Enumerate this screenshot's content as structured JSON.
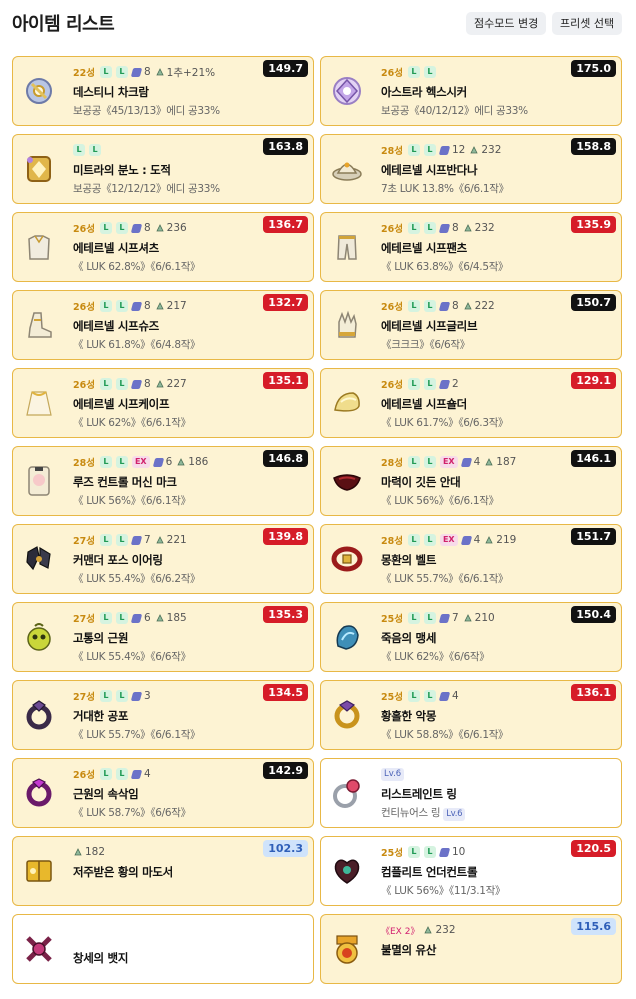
{
  "header": {
    "title": "아이템 리스트",
    "btn_score": "점수모드 변경",
    "btn_preset": "프리셋 선택"
  },
  "items": [
    {
      "star": "22성",
      "l": 2,
      "ex": "",
      "sc": "8",
      "stone": "1추+21%",
      "ex2": "",
      "lv": "",
      "name": "데스티니 차크람",
      "opt": "보공공《45/13/13》에디 공33%",
      "score": "149.7",
      "sc_color": "dark",
      "bg": "yellow",
      "icon": "chakram-icon"
    },
    {
      "star": "26성",
      "l": 2,
      "ex": "",
      "sc": "",
      "stone": "",
      "ex2": "",
      "lv": "",
      "name": "아스트라 헥스시커",
      "opt": "보공공《40/12/12》에디 공33%",
      "score": "175.0",
      "sc_color": "dark",
      "bg": "yellow",
      "icon": "secondary-weapon-icon"
    },
    {
      "star": "",
      "l": 2,
      "ex": "",
      "sc": "",
      "stone": "",
      "ex2": "",
      "lv": "",
      "name": "미트라의 분노 : 도적",
      "opt": "보공공《12/12/12》에디 공33%",
      "score": "163.8",
      "sc_color": "dark",
      "bg": "yellow",
      "icon": "emblem-icon"
    },
    {
      "star": "28성",
      "l": 2,
      "ex": "",
      "sc": "12",
      "stone": "232",
      "ex2": "",
      "lv": "",
      "name": "에테르넬 시프반다나",
      "opt": "7초 LUK 13.8%《6/6.1작》",
      "score": "158.8",
      "sc_color": "dark",
      "bg": "yellow",
      "icon": "hat-icon"
    },
    {
      "star": "26성",
      "l": 2,
      "ex": "",
      "sc": "8",
      "stone": "236",
      "ex2": "",
      "lv": "",
      "name": "에테르넬 시프셔츠",
      "opt": "《 LUK 62.8%》《6/6.1작》",
      "score": "136.7",
      "sc_color": "red",
      "bg": "yellow",
      "icon": "shirt-icon"
    },
    {
      "star": "26성",
      "l": 2,
      "ex": "",
      "sc": "8",
      "stone": "232",
      "ex2": "",
      "lv": "",
      "name": "에테르넬 시프팬츠",
      "opt": "《 LUK 63.8%》《6/4.5작》",
      "score": "135.9",
      "sc_color": "red",
      "bg": "yellow",
      "icon": "pants-icon"
    },
    {
      "star": "26성",
      "l": 2,
      "ex": "",
      "sc": "8",
      "stone": "217",
      "ex2": "",
      "lv": "",
      "name": "에테르넬 시프슈즈",
      "opt": "《 LUK 61.8%》《6/4.8작》",
      "score": "132.7",
      "sc_color": "red",
      "bg": "yellow",
      "icon": "shoes-icon"
    },
    {
      "star": "26성",
      "l": 2,
      "ex": "",
      "sc": "8",
      "stone": "222",
      "ex2": "",
      "lv": "",
      "name": "에테르넬 시프글리브",
      "opt": "《크크크》《6/6작》",
      "score": "150.7",
      "sc_color": "dark",
      "bg": "yellow",
      "icon": "glove-icon"
    },
    {
      "star": "26성",
      "l": 2,
      "ex": "",
      "sc": "8",
      "stone": "227",
      "ex2": "",
      "lv": "",
      "name": "에테르넬 시프케이프",
      "opt": "《 LUK 62%》《6/6.1작》",
      "score": "135.1",
      "sc_color": "red",
      "bg": "yellow",
      "icon": "cape-icon"
    },
    {
      "star": "26성",
      "l": 2,
      "ex": "",
      "sc": "2",
      "stone": "",
      "ex2": "",
      "lv": "",
      "name": "에테르넬 시프숄더",
      "opt": "《 LUK 61.7%》《6/6.3작》",
      "score": "129.1",
      "sc_color": "red",
      "bg": "yellow",
      "icon": "shoulder-icon"
    },
    {
      "star": "28성",
      "l": 2,
      "ex": "EX",
      "sc": "6",
      "stone": "186",
      "ex2": "",
      "lv": "",
      "name": "루즈 컨트롤 머신 마크",
      "opt": "《 LUK 56%》《6/6.1작》",
      "score": "146.8",
      "sc_color": "dark",
      "bg": "yellow",
      "icon": "face-accessory-icon"
    },
    {
      "star": "28성",
      "l": 2,
      "ex": "EX",
      "sc": "4",
      "stone": "187",
      "ex2": "",
      "lv": "",
      "name": "마력이 깃든 안대",
      "opt": "《 LUK 56%》《6/6.1작》",
      "score": "146.1",
      "sc_color": "dark",
      "bg": "yellow",
      "icon": "eyepatch-icon"
    },
    {
      "star": "27성",
      "l": 2,
      "ex": "",
      "sc": "7",
      "stone": "221",
      "ex2": "",
      "lv": "",
      "name": "커맨더 포스 이어링",
      "opt": "《 LUK 55.4%》《6/6.2작》",
      "score": "139.8",
      "sc_color": "red",
      "bg": "yellow",
      "icon": "earring-icon"
    },
    {
      "star": "28성",
      "l": 2,
      "ex": "EX",
      "sc": "4",
      "stone": "219",
      "ex2": "",
      "lv": "",
      "name": "몽환의 벨트",
      "opt": "《 LUK 55.7%》《6/6.1작》",
      "score": "151.7",
      "sc_color": "dark",
      "bg": "yellow",
      "icon": "belt-icon"
    },
    {
      "star": "27성",
      "l": 2,
      "ex": "",
      "sc": "6",
      "stone": "185",
      "ex2": "",
      "lv": "",
      "name": "고통의 근원",
      "opt": "《 LUK 55.4%》《6/6작》",
      "score": "135.3",
      "sc_color": "red",
      "bg": "yellow",
      "icon": "pendant-icon"
    },
    {
      "star": "25성",
      "l": 2,
      "ex": "",
      "sc": "7",
      "stone": "210",
      "ex2": "",
      "lv": "",
      "name": "죽음의 맹세",
      "opt": "《 LUK 62%》《6/6작》",
      "score": "150.4",
      "sc_color": "dark",
      "bg": "yellow",
      "icon": "pendant-blue-icon"
    },
    {
      "star": "27성",
      "l": 2,
      "ex": "",
      "sc": "3",
      "stone": "",
      "ex2": "",
      "lv": "",
      "name": "거대한 공포",
      "opt": "《 LUK 55.7%》《6/6.1작》",
      "score": "134.5",
      "sc_color": "red",
      "bg": "yellow",
      "icon": "ring-dark-icon"
    },
    {
      "star": "25성",
      "l": 2,
      "ex": "",
      "sc": "4",
      "stone": "",
      "ex2": "",
      "lv": "",
      "name": "황홀한 악몽",
      "opt": "《 LUK 58.8%》《6/6.1작》",
      "score": "136.1",
      "sc_color": "red",
      "bg": "yellow",
      "icon": "ring-gold-icon"
    },
    {
      "star": "26성",
      "l": 2,
      "ex": "",
      "sc": "4",
      "stone": "",
      "ex2": "",
      "lv": "",
      "name": "근원의 속삭임",
      "opt": "《 LUK 58.7%》《6/6작》",
      "score": "142.9",
      "sc_color": "dark",
      "bg": "yellow",
      "icon": "ring-purple-icon"
    },
    {
      "star": "",
      "l": 0,
      "ex": "",
      "sc": "",
      "stone": "",
      "ex2": "",
      "lv": "Lv.6",
      "name": "리스트레인트 링",
      "opt": "컨티뉴어스 링",
      "opt_lv": "Lv.6",
      "score": "",
      "sc_color": "",
      "bg": "white",
      "icon": "ring-silver-icon"
    },
    {
      "star": "",
      "l": 0,
      "ex": "",
      "sc": "",
      "stone": "182",
      "ex2": "",
      "lv": "",
      "name": "저주받은 황의 마도서",
      "opt": "",
      "score": "102.3",
      "sc_color": "blue",
      "bg": "yellow",
      "icon": "book-icon"
    },
    {
      "star": "25성",
      "l": 2,
      "ex": "",
      "sc": "10",
      "stone": "",
      "ex2": "",
      "lv": "",
      "name": "컴플리트 언더컨트롤",
      "opt": "《 LUK 56%》《11/3.1작》",
      "score": "120.5",
      "sc_color": "red",
      "bg": "white",
      "icon": "heart-icon"
    },
    {
      "star": "",
      "l": 0,
      "ex": "",
      "sc": "",
      "stone": "",
      "ex2": "",
      "lv": "",
      "name": "창세의 뱃지",
      "opt": "",
      "score": "",
      "sc_color": "",
      "bg": "white",
      "icon": "badge-icon"
    },
    {
      "star": "",
      "l": 0,
      "ex": "",
      "sc": "",
      "stone": "232",
      "ex2": "《EX 2》",
      "lv": "",
      "name": "불멸의 유산",
      "opt": "",
      "score": "115.6",
      "sc_color": "blue",
      "bg": "yellow",
      "icon": "medal-icon"
    }
  ]
}
